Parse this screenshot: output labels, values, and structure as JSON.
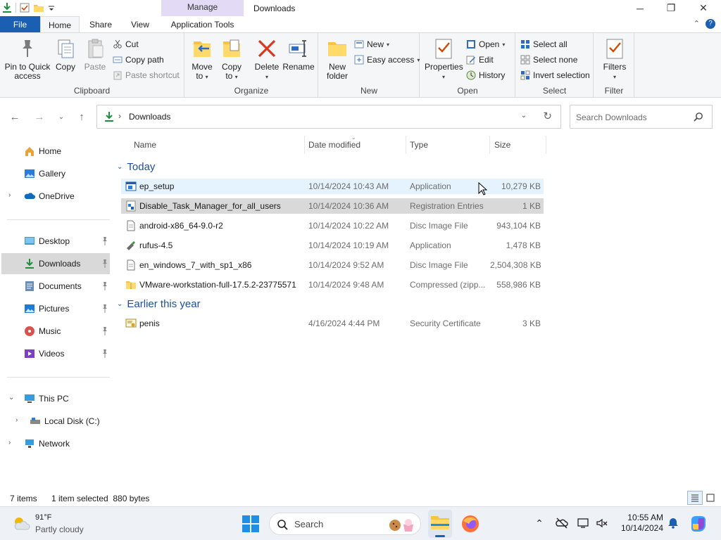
{
  "window": {
    "title": "Downloads",
    "context_tab_group": "Manage",
    "minimize_glyph": "─",
    "maximize_glyph": "❐",
    "close_glyph": "✕"
  },
  "tabs": {
    "file": "File",
    "home": "Home",
    "share": "Share",
    "view": "View",
    "application_tools": "Application Tools"
  },
  "help_glyph": "?",
  "ribbon": {
    "clipboard": {
      "label": "Clipboard",
      "pin_line1": "Pin to Quick",
      "pin_line2": "access",
      "copy": "Copy",
      "paste": "Paste",
      "cut": "Cut",
      "copy_path": "Copy path",
      "paste_shortcut": "Paste shortcut"
    },
    "organize": {
      "label": "Organize",
      "move_line1": "Move",
      "move_line2": "to",
      "copy_line1": "Copy",
      "copy_line2": "to",
      "delete": "Delete",
      "rename": "Rename"
    },
    "new": {
      "label": "New",
      "folder_line1": "New",
      "folder_line2": "folder",
      "new_item": "New",
      "easy_access": "Easy access"
    },
    "open": {
      "label": "Open",
      "properties": "Properties",
      "open": "Open",
      "edit": "Edit",
      "history": "History"
    },
    "select": {
      "label": "Select",
      "select_all": "Select all",
      "select_none": "Select none",
      "invert": "Invert selection"
    },
    "filter": {
      "label": "Filter",
      "filters": "Filters"
    }
  },
  "address": {
    "path": "Downloads",
    "separator": "›"
  },
  "search": {
    "placeholder": "Search Downloads"
  },
  "navpane": {
    "home": "Home",
    "gallery": "Gallery",
    "onedrive": "OneDrive",
    "desktop": "Desktop",
    "downloads": "Downloads",
    "documents": "Documents",
    "pictures": "Pictures",
    "music": "Music",
    "videos": "Videos",
    "this_pc": "This PC",
    "local_disk": "Local Disk (C:)",
    "network": "Network"
  },
  "columns": {
    "name": "Name",
    "date": "Date modified",
    "type": "Type",
    "size": "Size"
  },
  "groups": {
    "today": "Today",
    "earlier": "Earlier this year"
  },
  "files": [
    {
      "name": "ep_setup",
      "date": "10/14/2024 10:43 AM",
      "type": "Application",
      "size": "10,279 KB",
      "icon": "app-window-icon"
    },
    {
      "name": "Disable_Task_Manager_for_all_users",
      "date": "10/14/2024 10:36 AM",
      "type": "Registration Entries",
      "size": "1 KB",
      "icon": "registry-file-icon"
    },
    {
      "name": "android-x86_64-9.0-r2",
      "date": "10/14/2024 10:22 AM",
      "type": "Disc Image File",
      "size": "943,104 KB",
      "icon": "document-icon"
    },
    {
      "name": "rufus-4.5",
      "date": "10/14/2024 10:19 AM",
      "type": "Application",
      "size": "1,478 KB",
      "icon": "usb-drive-icon"
    },
    {
      "name": "en_windows_7_with_sp1_x86",
      "date": "10/14/2024 9:52 AM",
      "type": "Disc Image File",
      "size": "2,504,308 KB",
      "icon": "document-icon"
    },
    {
      "name": "VMware-workstation-full-17.5.2-23775571",
      "date": "10/14/2024 9:48 AM",
      "type": "Compressed (zipp...",
      "size": "558,986 KB",
      "icon": "zip-folder-icon"
    }
  ],
  "files_earlier": [
    {
      "name": "penis",
      "date": "4/16/2024 4:44 PM",
      "type": "Security Certificate",
      "size": "3 KB",
      "icon": "certificate-icon"
    }
  ],
  "status": {
    "count": "7 items",
    "selection": "1 item selected  880 bytes"
  },
  "taskbar": {
    "temperature": "91°F",
    "condition": "Partly cloudy",
    "search_label": "Search",
    "time": "10:55 AM",
    "date": "10/14/2024"
  },
  "colors": {
    "accent": "#1a5fb4",
    "group_header": "#1e4e9c",
    "selected_row": "#d9d9d9",
    "hover_row": "#e5f3ff",
    "context_tab": "#e3dbf5"
  }
}
